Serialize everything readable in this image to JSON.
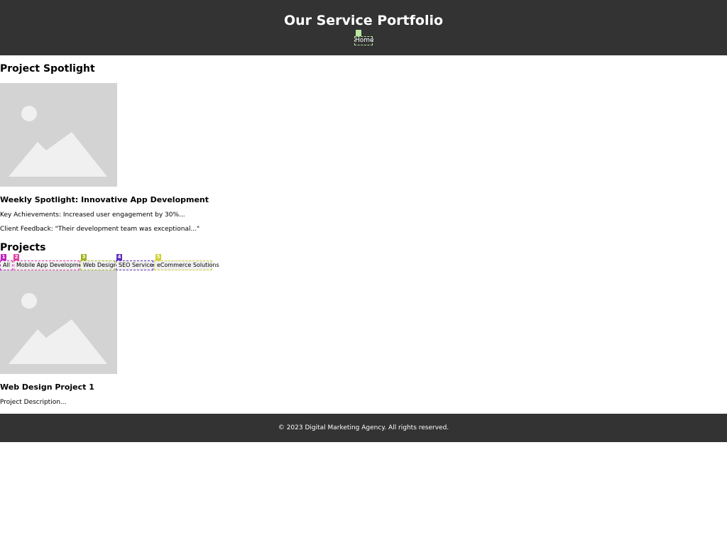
{
  "header": {
    "title": "Our Service Portfolio",
    "nav": {
      "home_label": "Home"
    }
  },
  "spotlight": {
    "heading": "Project Spotlight",
    "card_title": "Weekly Spotlight: Innovative App Development",
    "achievements": "Key Achievements: Increased user engagement by 30%...",
    "feedback": "Client Feedback: \"Their development team was exceptional...\"",
    "image_icon": "image-placeholder-icon"
  },
  "projects": {
    "heading": "Projects",
    "filters": [
      {
        "label": "All",
        "marker": "1",
        "marker_color": "#c020c0"
      },
      {
        "label": "Mobile App Development",
        "marker": "2",
        "marker_color": "#e040a0"
      },
      {
        "label": "Web Design",
        "marker": "3",
        "marker_color": "#a0b020"
      },
      {
        "label": "SEO Services",
        "marker": "4",
        "marker_color": "#6030c0"
      },
      {
        "label": "eCommerce Solutions",
        "marker": "5",
        "marker_color": "#d0d030"
      }
    ],
    "items": [
      {
        "title": "Web Design Project 1",
        "description": "Project Description..."
      }
    ]
  },
  "footer": {
    "text": "© 2023 Digital Marketing Agency. All rights reserved."
  },
  "colors": {
    "header_bg": "#333333",
    "footer_bg": "#333333",
    "placeholder_bg": "#d3d3d3",
    "placeholder_shape": "#f0f0f0",
    "home_marker": "#b9e8a0"
  }
}
